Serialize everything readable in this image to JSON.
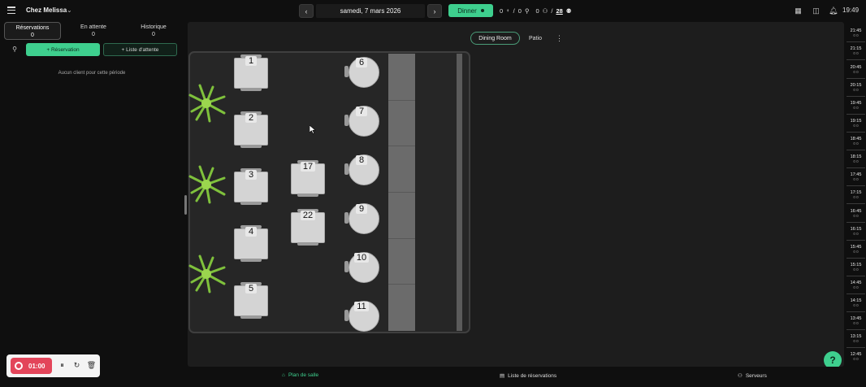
{
  "header": {
    "restaurant": "Chez Melissa",
    "date": "samedi, 7 mars 2026",
    "service": "Dinner",
    "covers_seated": "0",
    "covers_total": "0",
    "guests": "0",
    "capacity": "28",
    "time": "19:49"
  },
  "sidebar": {
    "tabs": [
      {
        "label": "Réservations",
        "count": "0"
      },
      {
        "label": "En attente",
        "count": "0"
      },
      {
        "label": "Historique",
        "count": "0"
      }
    ],
    "reservation_button": "Réservation",
    "waitlist_button": "Liste d'attente",
    "empty_message": "Aucun client pour cette période"
  },
  "rooms": [
    "Dining Room",
    "Patio"
  ],
  "tables": {
    "square": [
      "1",
      "2",
      "3",
      "4",
      "5",
      "17",
      "22"
    ],
    "round": [
      "6",
      "7",
      "8",
      "9",
      "10",
      "11"
    ]
  },
  "timeline": [
    {
      "time": "21:45",
      "count": "0 0"
    },
    {
      "time": "21:15",
      "count": "0 0"
    },
    {
      "time": "20:45",
      "count": "0 0"
    },
    {
      "time": "20:15",
      "count": "0 0"
    },
    {
      "time": "19:45",
      "count": "0 0"
    },
    {
      "time": "19:15",
      "count": "0 0"
    },
    {
      "time": "18:45",
      "count": "0 0"
    },
    {
      "time": "18:15",
      "count": "0 0"
    },
    {
      "time": "17:45",
      "count": "0 0"
    },
    {
      "time": "17:15",
      "count": "0 0"
    },
    {
      "time": "16:45",
      "count": "0 0"
    },
    {
      "time": "16:15",
      "count": "0 0"
    },
    {
      "time": "15:45",
      "count": "0 0"
    },
    {
      "time": "15:15",
      "count": "0 0"
    },
    {
      "time": "14:45",
      "count": "0 0"
    },
    {
      "time": "14:15",
      "count": "0 0"
    },
    {
      "time": "13:45",
      "count": "0 0"
    },
    {
      "time": "13:15",
      "count": "0 0"
    },
    {
      "time": "12:45",
      "count": "0 0"
    }
  ],
  "bottom_nav": [
    "Plan de salle",
    "Liste de réservations",
    "Serveurs"
  ],
  "recorder": {
    "time": "01:00"
  },
  "help": "?",
  "colors": {
    "accent": "#3ecf8e",
    "record": "#e3455a",
    "panel": "#1d1d1d"
  }
}
